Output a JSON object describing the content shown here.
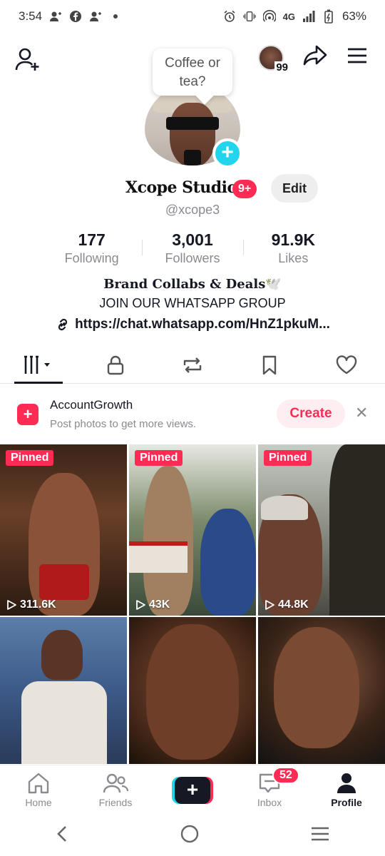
{
  "status_bar": {
    "time": "3:54",
    "network": "4G",
    "battery": "63%"
  },
  "header": {
    "bubble_text": "Coffee or tea?",
    "avatar_badge": "99"
  },
  "profile": {
    "name": "Xcope Studio",
    "notification_badge": "9+",
    "edit_label": "Edit",
    "handle": "@xcope3"
  },
  "stats": [
    {
      "value": "177",
      "label": "Following"
    },
    {
      "value": "3,001",
      "label": "Followers"
    },
    {
      "value": "91.9K",
      "label": "Likes"
    }
  ],
  "bio": {
    "line1": "Brand Collabs & Deals🕊️",
    "line2": "JOIN OUR WHATSAPP GROUP",
    "link": "https://chat.whatsapp.com/HnZ1pkuM..."
  },
  "tabs": [
    "videos",
    "private",
    "reposts",
    "favorites",
    "liked"
  ],
  "promo": {
    "title": "AccountGrowth",
    "subtitle": "Post photos to get more views.",
    "create_label": "Create"
  },
  "videos": [
    {
      "pinned": "Pinned",
      "views": "311.6K"
    },
    {
      "pinned": "Pinned",
      "views": "43K"
    },
    {
      "pinned": "Pinned",
      "views": "44.8K"
    },
    {
      "pinned": "",
      "views": ""
    },
    {
      "pinned": "",
      "views": ""
    },
    {
      "pinned": "",
      "views": ""
    }
  ],
  "bottom_nav": {
    "home": "Home",
    "friends": "Friends",
    "inbox": "Inbox",
    "inbox_badge": "52",
    "profile": "Profile"
  },
  "colors": {
    "accent": "#fe2c55",
    "cyan": "#20d5ec",
    "text": "#161823",
    "muted": "#8a8b91"
  }
}
